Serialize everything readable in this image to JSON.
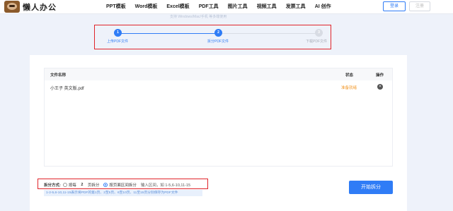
{
  "header": {
    "logo_text": "懒人办公",
    "nav": [
      "PPT模板",
      "Word模板",
      "Excel模板",
      "PDF工具",
      "图片工具",
      "视频工具",
      "发票工具",
      "AI 创作"
    ],
    "login": "登录",
    "register": "注册"
  },
  "steps": {
    "faint_text": "支持 Windows/Mac/手机 等多端使用",
    "items": [
      {
        "num": "1",
        "label": "上传PDF文件"
      },
      {
        "num": "2",
        "label": "拆分PDF文件"
      },
      {
        "num": "3",
        "label": "下载PDF文件"
      }
    ]
  },
  "table": {
    "col_name": "文件名称",
    "col_status": "状态",
    "col_action": "操作",
    "rows": [
      {
        "name": "小王子 英文版.pdf",
        "status": "准备就绪",
        "action_icon": "close-circle-icon"
      }
    ]
  },
  "split": {
    "label": "拆分方式:",
    "option1_prefix": "按每",
    "pages": "2",
    "option1_suffix": "页拆分",
    "option2_label": "按页面区间拆分",
    "range_hint": "输入区间，如 1-5,6-10,11-15",
    "hint": "1-2-5,6-10,11-15表示将PDF的第1页、2至5页、6至10页、11至15页分别保存为PDF文件"
  },
  "start_button": "开始拆分",
  "colors": {
    "accent": "#2f7cf6",
    "highlight_box": "#e0242a",
    "status_ready": "#f39a2d"
  }
}
